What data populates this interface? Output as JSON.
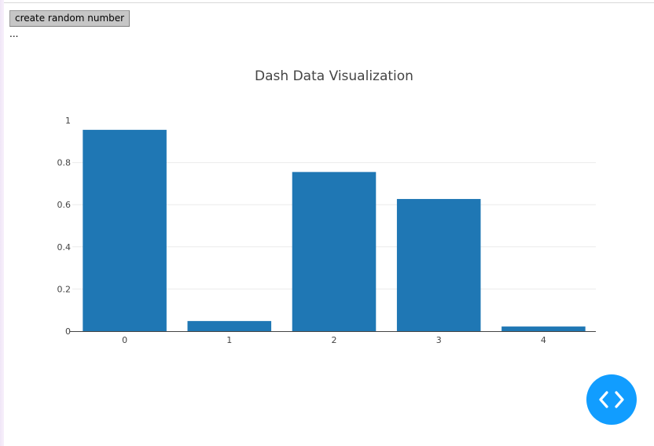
{
  "button": {
    "label": "create random number"
  },
  "output": {
    "text": "..."
  },
  "chart_data": {
    "type": "bar",
    "title": "Dash Data Visualization",
    "xlabel": "",
    "ylabel": "",
    "categories": [
      "0",
      "1",
      "2",
      "3",
      "4"
    ],
    "values": [
      0.955,
      0.048,
      0.755,
      0.627,
      0.022
    ],
    "ylim": [
      0,
      1.0
    ],
    "yticks": [
      0,
      0.2,
      0.4,
      0.6,
      0.8,
      1
    ],
    "ytick_labels": [
      "0",
      "0.2",
      "0.4",
      "0.6",
      "0.8",
      "1"
    ],
    "bar_color": "#1f77b4",
    "grid": true,
    "legend": "none"
  },
  "devtools": {
    "icon": "code-brackets-icon",
    "color": "#119dff"
  }
}
